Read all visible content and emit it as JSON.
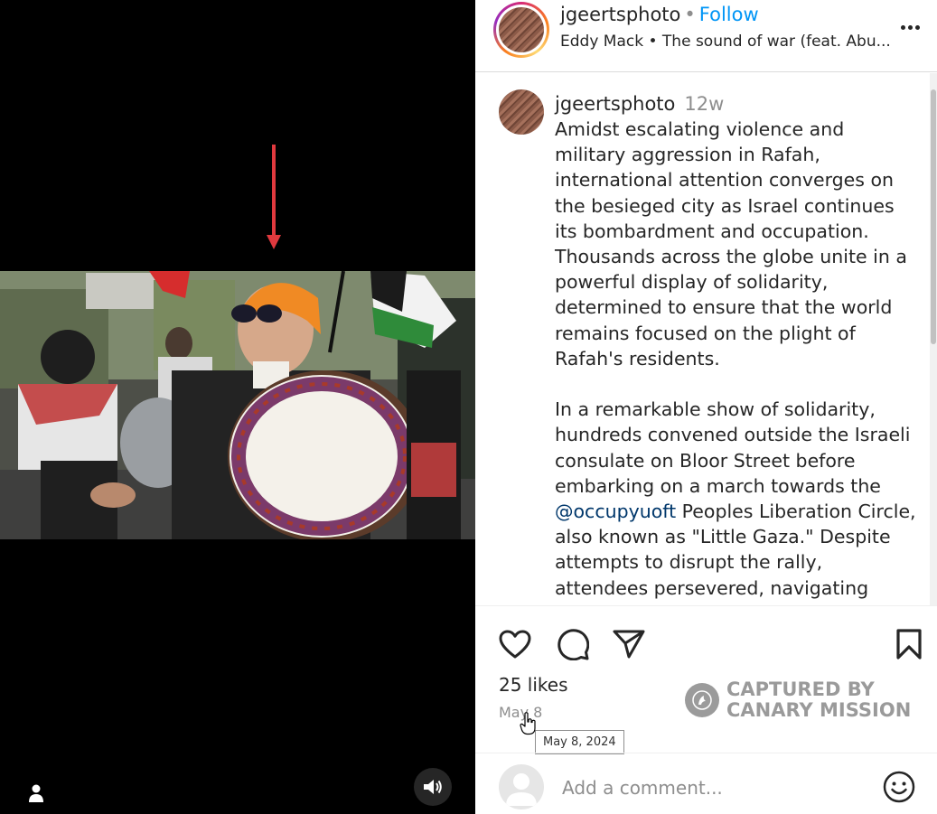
{
  "header": {
    "username": "jgeertsphoto",
    "separator": "•",
    "follow_label": "Follow",
    "audio_artist": "Eddy Mack",
    "audio_separator": "•",
    "audio_title": "The sound of war (feat. Abu..."
  },
  "caption": {
    "username": "jgeertsphoto",
    "time_ago": "12w",
    "paragraph1": "Amidst escalating violence and military aggression in Rafah, international attention converges on the besieged city as Israel continues its bombardment and occupation. Thousands across the globe unite in a powerful display of solidarity, determined to ensure that the world remains focused on the plight of Rafah's residents.",
    "paragraph2_before": "In a remarkable show of solidarity, hundreds convened outside the Israeli consulate on Bloor Street before embarking on a march towards the ",
    "mention": "@occupyuoft",
    "paragraph2_after": " Peoples Liberation Circle, also known as \"Little Gaza.\" Despite attempts to disrupt the rally, attendees persevered, navigating obstacles with resolve and bravery."
  },
  "stats": {
    "likes": "25 likes",
    "date": "May 8",
    "tooltip": "May 8, 2024"
  },
  "watermark": {
    "line1": "CAPTURED BY",
    "line2": "CANARY MISSION"
  },
  "comment": {
    "placeholder": "Add a comment..."
  },
  "icons": {
    "like": "heart-icon",
    "comment": "comment-bubble-icon",
    "share": "paper-plane-icon",
    "save": "bookmark-icon",
    "more": "more-options-icon",
    "mute": "speaker-icon",
    "user_tag": "person-icon",
    "emoji": "smiley-icon"
  },
  "colors": {
    "follow": "#0095f6",
    "mention": "#00376b",
    "annotation_arrow": "#e0393e"
  }
}
